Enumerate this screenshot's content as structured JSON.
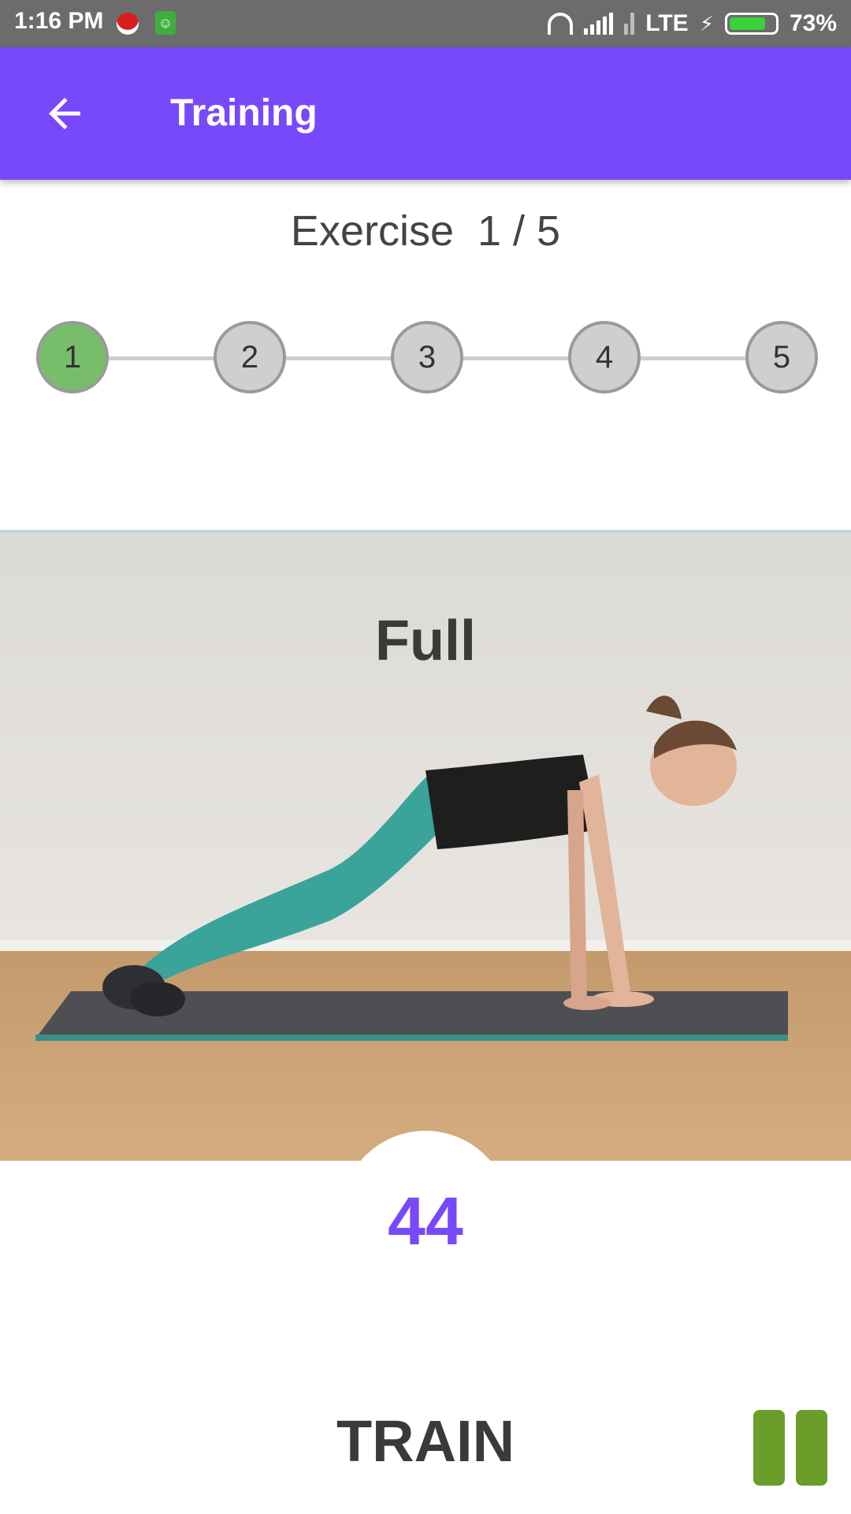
{
  "status_bar": {
    "time": "1:16 PM",
    "network": "LTE",
    "battery_percent": "73%",
    "battery_level": 0.73,
    "icons": [
      "screen-record-icon",
      "android-notification-icon",
      "headset-icon",
      "signal-icon",
      "signal-icon",
      "charging-icon",
      "battery-icon"
    ]
  },
  "app_bar": {
    "title": "Training",
    "back_icon": "arrow-left-icon",
    "color": "#7749fb"
  },
  "exercise": {
    "label": "Exercise",
    "progress": "1 / 5"
  },
  "stepper": {
    "steps": [
      "1",
      "2",
      "3",
      "4",
      "5"
    ],
    "active_index": 0,
    "active_color": "#78bd6a",
    "inactive_color": "#cfcfcf"
  },
  "workout": {
    "name": "Full",
    "timer": "44",
    "phase": "TRAIN"
  },
  "controls": {
    "pause_icon": "pause-icon",
    "pause_color": "#6a9d2a"
  }
}
